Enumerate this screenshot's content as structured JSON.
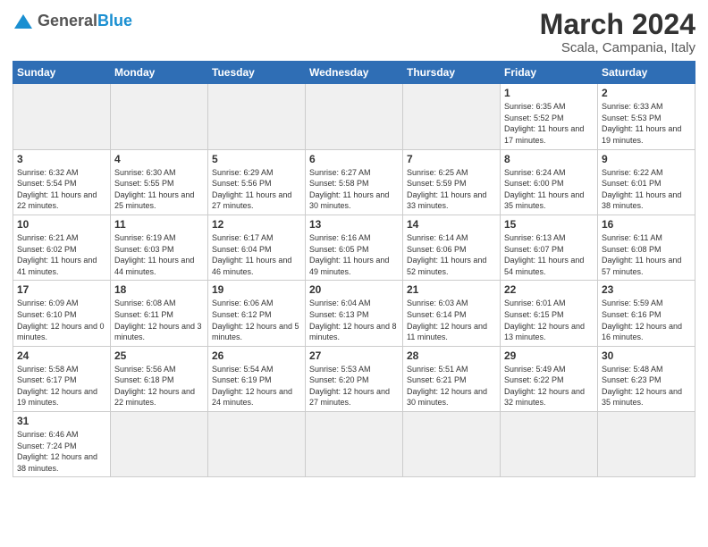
{
  "header": {
    "logo_general": "General",
    "logo_blue": "Blue",
    "month_title": "March 2024",
    "location": "Scala, Campania, Italy"
  },
  "days_of_week": [
    "Sunday",
    "Monday",
    "Tuesday",
    "Wednesday",
    "Thursday",
    "Friday",
    "Saturday"
  ],
  "weeks": [
    [
      {
        "day": "",
        "info": ""
      },
      {
        "day": "",
        "info": ""
      },
      {
        "day": "",
        "info": ""
      },
      {
        "day": "",
        "info": ""
      },
      {
        "day": "",
        "info": ""
      },
      {
        "day": "1",
        "info": "Sunrise: 6:35 AM\nSunset: 5:52 PM\nDaylight: 11 hours\nand 17 minutes."
      },
      {
        "day": "2",
        "info": "Sunrise: 6:33 AM\nSunset: 5:53 PM\nDaylight: 11 hours\nand 19 minutes."
      }
    ],
    [
      {
        "day": "3",
        "info": "Sunrise: 6:32 AM\nSunset: 5:54 PM\nDaylight: 11 hours\nand 22 minutes."
      },
      {
        "day": "4",
        "info": "Sunrise: 6:30 AM\nSunset: 5:55 PM\nDaylight: 11 hours\nand 25 minutes."
      },
      {
        "day": "5",
        "info": "Sunrise: 6:29 AM\nSunset: 5:56 PM\nDaylight: 11 hours\nand 27 minutes."
      },
      {
        "day": "6",
        "info": "Sunrise: 6:27 AM\nSunset: 5:58 PM\nDaylight: 11 hours\nand 30 minutes."
      },
      {
        "day": "7",
        "info": "Sunrise: 6:25 AM\nSunset: 5:59 PM\nDaylight: 11 hours\nand 33 minutes."
      },
      {
        "day": "8",
        "info": "Sunrise: 6:24 AM\nSunset: 6:00 PM\nDaylight: 11 hours\nand 35 minutes."
      },
      {
        "day": "9",
        "info": "Sunrise: 6:22 AM\nSunset: 6:01 PM\nDaylight: 11 hours\nand 38 minutes."
      }
    ],
    [
      {
        "day": "10",
        "info": "Sunrise: 6:21 AM\nSunset: 6:02 PM\nDaylight: 11 hours\nand 41 minutes."
      },
      {
        "day": "11",
        "info": "Sunrise: 6:19 AM\nSunset: 6:03 PM\nDaylight: 11 hours\nand 44 minutes."
      },
      {
        "day": "12",
        "info": "Sunrise: 6:17 AM\nSunset: 6:04 PM\nDaylight: 11 hours\nand 46 minutes."
      },
      {
        "day": "13",
        "info": "Sunrise: 6:16 AM\nSunset: 6:05 PM\nDaylight: 11 hours\nand 49 minutes."
      },
      {
        "day": "14",
        "info": "Sunrise: 6:14 AM\nSunset: 6:06 PM\nDaylight: 11 hours\nand 52 minutes."
      },
      {
        "day": "15",
        "info": "Sunrise: 6:13 AM\nSunset: 6:07 PM\nDaylight: 11 hours\nand 54 minutes."
      },
      {
        "day": "16",
        "info": "Sunrise: 6:11 AM\nSunset: 6:08 PM\nDaylight: 11 hours\nand 57 minutes."
      }
    ],
    [
      {
        "day": "17",
        "info": "Sunrise: 6:09 AM\nSunset: 6:10 PM\nDaylight: 12 hours\nand 0 minutes."
      },
      {
        "day": "18",
        "info": "Sunrise: 6:08 AM\nSunset: 6:11 PM\nDaylight: 12 hours\nand 3 minutes."
      },
      {
        "day": "19",
        "info": "Sunrise: 6:06 AM\nSunset: 6:12 PM\nDaylight: 12 hours\nand 5 minutes."
      },
      {
        "day": "20",
        "info": "Sunrise: 6:04 AM\nSunset: 6:13 PM\nDaylight: 12 hours\nand 8 minutes."
      },
      {
        "day": "21",
        "info": "Sunrise: 6:03 AM\nSunset: 6:14 PM\nDaylight: 12 hours\nand 11 minutes."
      },
      {
        "day": "22",
        "info": "Sunrise: 6:01 AM\nSunset: 6:15 PM\nDaylight: 12 hours\nand 13 minutes."
      },
      {
        "day": "23",
        "info": "Sunrise: 5:59 AM\nSunset: 6:16 PM\nDaylight: 12 hours\nand 16 minutes."
      }
    ],
    [
      {
        "day": "24",
        "info": "Sunrise: 5:58 AM\nSunset: 6:17 PM\nDaylight: 12 hours\nand 19 minutes."
      },
      {
        "day": "25",
        "info": "Sunrise: 5:56 AM\nSunset: 6:18 PM\nDaylight: 12 hours\nand 22 minutes."
      },
      {
        "day": "26",
        "info": "Sunrise: 5:54 AM\nSunset: 6:19 PM\nDaylight: 12 hours\nand 24 minutes."
      },
      {
        "day": "27",
        "info": "Sunrise: 5:53 AM\nSunset: 6:20 PM\nDaylight: 12 hours\nand 27 minutes."
      },
      {
        "day": "28",
        "info": "Sunrise: 5:51 AM\nSunset: 6:21 PM\nDaylight: 12 hours\nand 30 minutes."
      },
      {
        "day": "29",
        "info": "Sunrise: 5:49 AM\nSunset: 6:22 PM\nDaylight: 12 hours\nand 32 minutes."
      },
      {
        "day": "30",
        "info": "Sunrise: 5:48 AM\nSunset: 6:23 PM\nDaylight: 12 hours\nand 35 minutes."
      }
    ],
    [
      {
        "day": "31",
        "info": "Sunrise: 6:46 AM\nSunset: 7:24 PM\nDaylight: 12 hours\nand 38 minutes."
      },
      {
        "day": "",
        "info": ""
      },
      {
        "day": "",
        "info": ""
      },
      {
        "day": "",
        "info": ""
      },
      {
        "day": "",
        "info": ""
      },
      {
        "day": "",
        "info": ""
      },
      {
        "day": "",
        "info": ""
      }
    ]
  ]
}
